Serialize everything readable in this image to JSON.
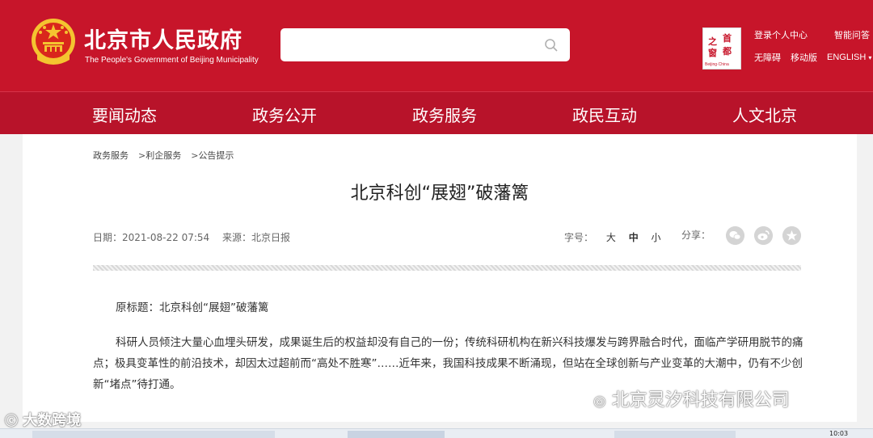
{
  "header": {
    "title": "北京市人民政府",
    "subtitle": "The People's Government of Beijing Municipality",
    "search_placeholder": "",
    "capital_logo": {
      "chars": [
        "首",
        "都",
        "之",
        "窗"
      ],
      "caption": "Beijing·China"
    },
    "links": {
      "login": "登录个人中心",
      "qa": "智能问答",
      "accessibility": "无障碍",
      "mobile": "移动版",
      "english": "ENGLISH",
      "english_arrow": "▾"
    }
  },
  "nav": {
    "items": [
      "要闻动态",
      "政务公开",
      "政务服务",
      "政民互动",
      "人文北京"
    ]
  },
  "breadcrumb": {
    "items": [
      "政务服务",
      "利企服务",
      "公告提示"
    ],
    "separator": ">"
  },
  "article": {
    "title": "北京科创“展翅”破藩篱",
    "date_label": "日期：",
    "date": "2021-08-22 07:54",
    "source_label": "来源：",
    "source": "北京日报",
    "font_size_label": "字号：",
    "font_sizes": [
      "大",
      "中",
      "小"
    ],
    "share_label": "分享：",
    "share_icons": [
      "wechat-icon",
      "weibo-icon",
      "favorite-icon"
    ],
    "original_title": "原标题：北京科创“展翅”破藩篱",
    "body": "科研人员倾注大量心血埋头研发，成果诞生后的权益却没有自己的一份；传统科研机构在新兴科技爆发与跨界融合时代，面临产学研用脱节的痛点；极具变革性的前沿技术，却因太过超前而“高处不胜寒”……近年来，我国科技成果不断涌现，但站在全球创新与产业变革的大潮中，仍有不少创新“堵点”待打通。"
  },
  "watermarks": {
    "right": "北京灵汐科技有限公司",
    "left": "大数跨境"
  },
  "taskbar": {
    "time": "10:03"
  },
  "colors": {
    "brand_red": "#c7152a",
    "nav_red": "#b8132a"
  }
}
